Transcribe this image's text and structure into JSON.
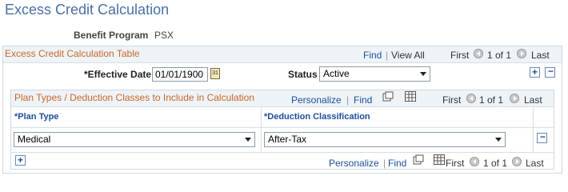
{
  "page": {
    "title": "Excess Credit Calculation"
  },
  "benefit_program": {
    "label": "Benefit Program",
    "value": "PSX"
  },
  "outer_grid": {
    "title": "Excess Credit Calculation Table",
    "find": "Find",
    "separator": "|",
    "view_all": "View All",
    "first": "First",
    "range": "1 of 1",
    "last": "Last"
  },
  "effective_date": {
    "label": "*Effective Date",
    "value": "01/01/1900"
  },
  "status": {
    "label": "Status",
    "value": "Active"
  },
  "inner_grid": {
    "title": "Plan Types / Deduction Classes to Include in Calculation",
    "personalize": "Personalize",
    "separator": "|",
    "find": "Find",
    "first": "First",
    "range": "1 of 1",
    "last": "Last",
    "columns": [
      "*Plan Type",
      "*Deduction Classification"
    ],
    "rows": [
      {
        "plan_type": "Medical",
        "deduction_classification": "After-Tax"
      }
    ],
    "footer": {
      "personalize": "Personalize",
      "separator": "|",
      "find": "Find",
      "first": "First",
      "range": "1 of 1",
      "last": "Last"
    }
  },
  "icons": {
    "calendar": "calendar-icon",
    "zoom": "zoom-icon",
    "grid": "spreadsheet-icon"
  }
}
